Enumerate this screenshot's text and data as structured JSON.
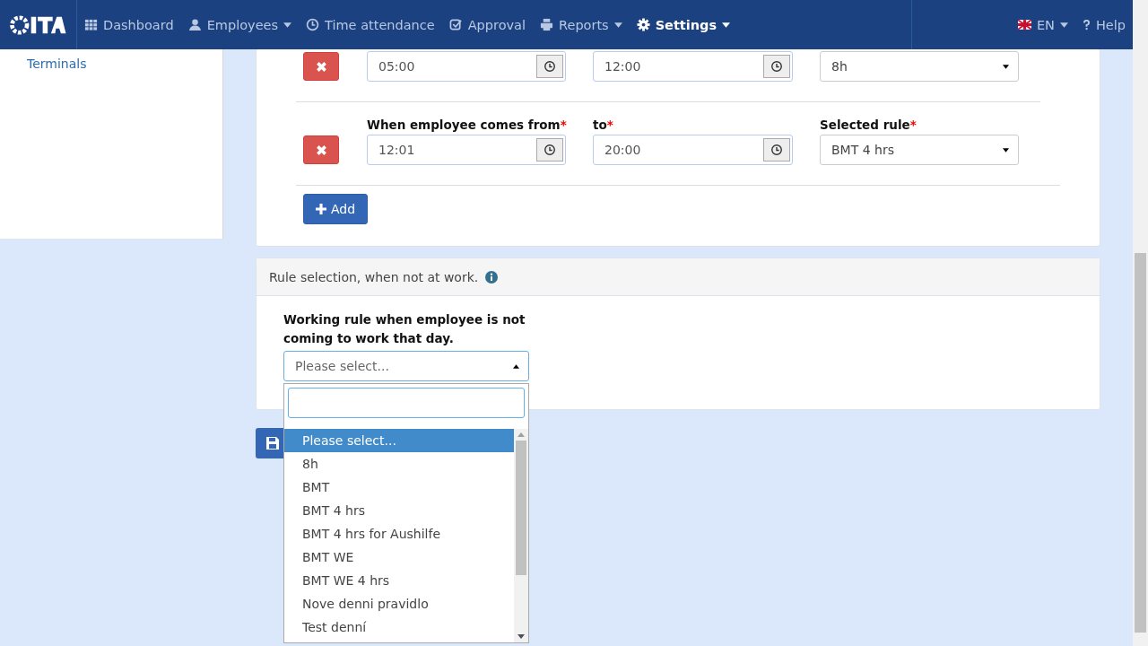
{
  "navbar": {
    "items": [
      {
        "label": "Dashboard",
        "dropdown": false,
        "selected": false
      },
      {
        "label": "Employees",
        "dropdown": true,
        "selected": false
      },
      {
        "label": "Time attendance",
        "dropdown": false,
        "selected": false
      },
      {
        "label": "Approval",
        "dropdown": false,
        "selected": false
      },
      {
        "label": "Reports",
        "dropdown": true,
        "selected": false
      },
      {
        "label": "Settings",
        "dropdown": true,
        "selected": true
      }
    ],
    "language": "EN",
    "help": "Help"
  },
  "sidebar": {
    "items": [
      {
        "label": "Terminals"
      }
    ]
  },
  "rules": [
    {
      "from": "05:00",
      "to": "12:00",
      "rule": "8h"
    },
    {
      "from_label": "When employee comes from",
      "to_label": "to",
      "rule_label": "Selected rule",
      "from": "12:01",
      "to": "20:00",
      "rule": "BMT 4 hrs"
    }
  ],
  "required_mark": "*",
  "add_button": "Add",
  "not_at_work": {
    "title": "Rule selection, when not at work.",
    "label": "Working rule when employee is not coming to work that day.",
    "placeholder": "Please select...",
    "options": [
      {
        "label": "Please select...",
        "selected": true
      },
      {
        "label": "8h",
        "selected": false
      },
      {
        "label": "BMT",
        "selected": false
      },
      {
        "label": "BMT 4 hrs",
        "selected": false
      },
      {
        "label": "BMT 4 hrs for Aushilfe",
        "selected": false
      },
      {
        "label": "BMT WE",
        "selected": false
      },
      {
        "label": "BMT WE 4 hrs",
        "selected": false
      },
      {
        "label": "Nove denni pravidlo",
        "selected": false
      },
      {
        "label": "Test denní",
        "selected": false
      }
    ]
  }
}
